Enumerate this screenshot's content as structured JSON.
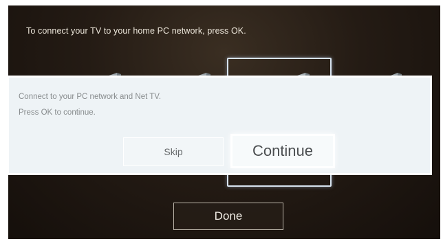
{
  "screen": {
    "instruction": "To connect your TV to your home PC network, press OK."
  },
  "dialog": {
    "line1": "Connect to your PC network and Net TV.",
    "line2": "Press OK to continue.",
    "skip_label": "Skip",
    "continue_label": "Continue"
  },
  "footer": {
    "done_label": "Done"
  },
  "colors": {
    "screen_background": "#241b14",
    "dialog_background": "#eef3f6",
    "focus_highlight": "#ffffff"
  }
}
